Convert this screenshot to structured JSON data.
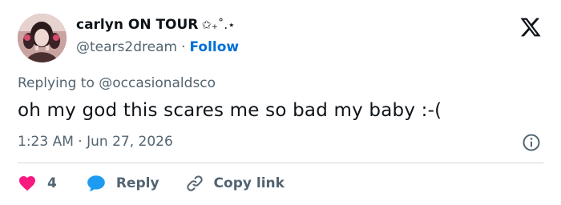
{
  "author": {
    "display_name": "carlyn ON TOUR",
    "name_decoration": "✩₊˚.⋆",
    "handle": "@tears2dream",
    "separator": "·",
    "follow_label": "Follow"
  },
  "tweet": {
    "replying_prefix": "Replying to",
    "replying_to": "@occasionaldsco",
    "text": "oh my god this scares me so bad my baby :-(",
    "time": "1:23 AM",
    "date_separator": "·",
    "date": "Jun 27, 2026"
  },
  "actions": {
    "like_count": "4",
    "reply_label": "Reply",
    "copy_link_label": "Copy link"
  },
  "colors": {
    "like": "#f91880",
    "reply": "#1d9bf0",
    "follow": "#006fd6",
    "secondary_text": "#536471"
  }
}
